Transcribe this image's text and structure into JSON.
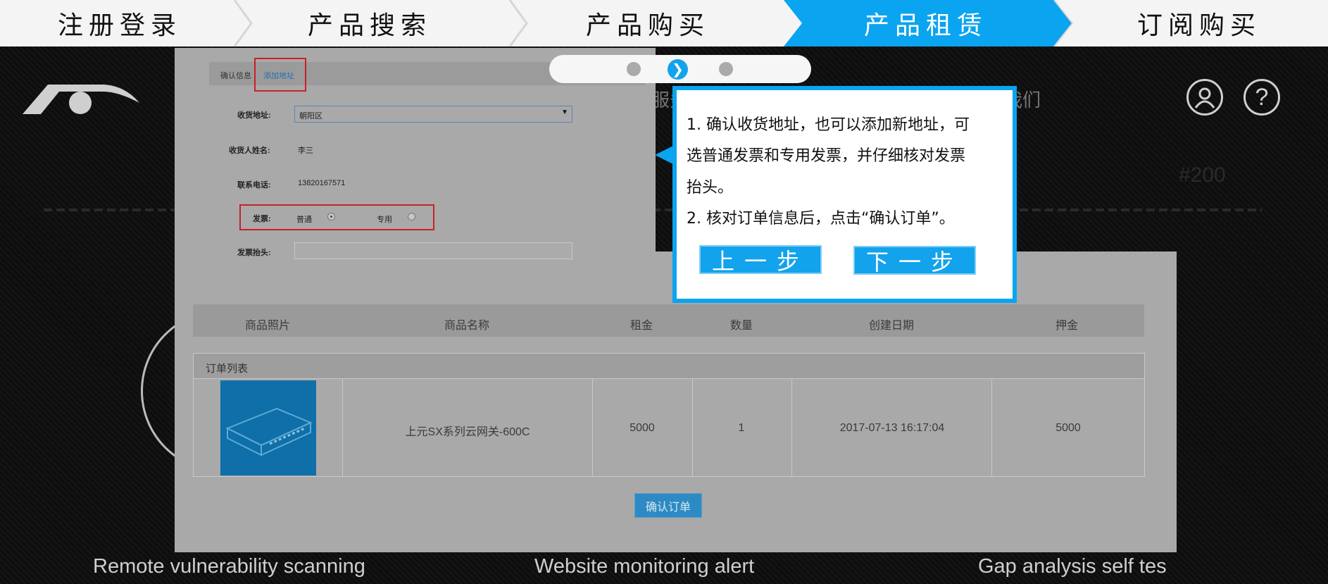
{
  "steps": [
    {
      "label": "注册登录"
    },
    {
      "label": "产品搜索"
    },
    {
      "label": "产品购买"
    },
    {
      "label": "产品租赁"
    },
    {
      "label": "订阅购买"
    }
  ],
  "active_step": "产品租赁",
  "colors": {
    "accent": "#12a3ec",
    "highlight_box": "#c8202a",
    "dark_bg": "#111111"
  },
  "header_icons": [
    "user-icon",
    "help-icon"
  ],
  "help_glyph": "?",
  "background": {
    "nav_text_left": "服务",
    "nav_text_right": "我们",
    "faded_number": "#200",
    "footer": [
      "Remote vulnerability scanning",
      "Website monitoring alert",
      "Gap analysis self tes"
    ]
  },
  "form": {
    "confirm_info": "确认信息",
    "add_address": "添加地址",
    "address_label": "收货地址:",
    "address_value": "朝阳区",
    "name_label": "收货人姓名:",
    "name_value": "李三",
    "phone_label": "联系电话:",
    "phone_value": "13820167571",
    "invoice_label": "发票:",
    "invoice_normal": "普通",
    "invoice_special": "专用",
    "invoice_selected": "普通",
    "invoice_title_label": "发票抬头:",
    "invoice_title_value": ""
  },
  "table": {
    "headers": [
      "商品照片",
      "商品名称",
      "租金",
      "数量",
      "创建日期",
      "押金"
    ],
    "section_title": "订单列表",
    "row": {
      "name": "上元SX系列云网关-600C",
      "rent": "5000",
      "quantity": "1",
      "date": "2017-07-13 16:17:04",
      "deposit": "5000"
    }
  },
  "confirm_order_button": "确认订单",
  "pager": {
    "current": 2,
    "total": 3,
    "arrow_icon": "chevron-right-icon",
    "arrow_glyph": "❯"
  },
  "tooltip": {
    "lines": [
      "1. 确认收货地址，也可以添加新地址，可",
      "选普通发票和专用发票，并仔细核对发票",
      "抬头。",
      "2. 核对订单信息后，点击“确认订单”。"
    ],
    "prev_button": "上一步",
    "next_button": "下一步"
  }
}
